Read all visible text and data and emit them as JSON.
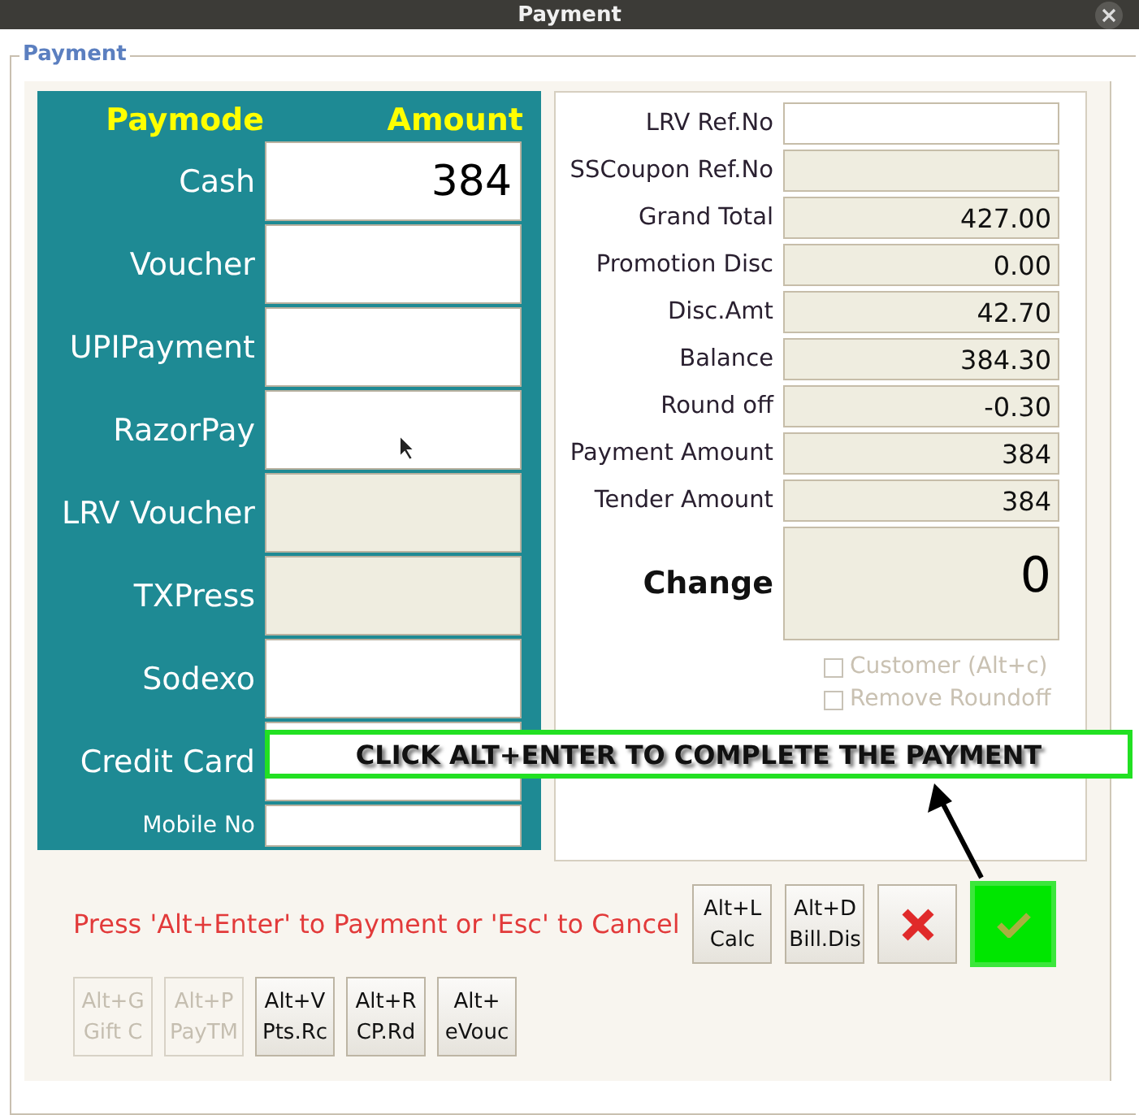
{
  "window": {
    "title": "Payment"
  },
  "group_title": "Payment",
  "paymodes": {
    "header_mode": "Paymode",
    "header_amount": "Amount",
    "rows": [
      {
        "label": "Cash",
        "value": "384",
        "disabled": false
      },
      {
        "label": "Voucher",
        "disabled": false
      },
      {
        "label": "UPIPayment",
        "disabled": false
      },
      {
        "label": "RazorPay",
        "disabled": false
      },
      {
        "label": "LRV Voucher",
        "disabled": true
      },
      {
        "label": "TXPress",
        "disabled": true
      },
      {
        "label": "Sodexo",
        "disabled": false
      },
      {
        "label": "Credit Card",
        "disabled": false
      }
    ],
    "mobile_label": "Mobile No"
  },
  "summary": [
    {
      "label": "LRV Ref.No",
      "disabled": false
    },
    {
      "label": "SSCoupon Ref.No",
      "disabled": true
    },
    {
      "label": "Grand Total",
      "value": "427.00",
      "disabled": true
    },
    {
      "label": "Promotion Disc",
      "value": "0.00",
      "disabled": true
    },
    {
      "label": "Disc.Amt",
      "value": "42.70",
      "disabled": true
    },
    {
      "label": "Balance",
      "value": "384.30",
      "disabled": true
    },
    {
      "label": "Round off",
      "value": "-0.30",
      "disabled": true
    },
    {
      "label": "Payment Amount",
      "value": "384",
      "disabled": true
    },
    {
      "label": "Tender Amount",
      "value": "384",
      "disabled": true
    }
  ],
  "change": {
    "label": "Change",
    "value": "0"
  },
  "options": [
    {
      "label": "Customer (Alt+c)",
      "checked": false
    },
    {
      "label": "Remove Roundoff",
      "checked": false
    }
  ],
  "hint": "Press 'Alt+Enter' to Payment or 'Esc' to Cancel",
  "action_buttons": [
    {
      "kind": "text",
      "line1": "Alt+L",
      "line2": "Calc"
    },
    {
      "kind": "text",
      "line1": "Alt+D",
      "line2": "Bill.Dis"
    },
    {
      "kind": "cancel"
    },
    {
      "kind": "confirm"
    }
  ],
  "shortcut_buttons": [
    {
      "line1": "Alt+G",
      "line2": "Gift C",
      "disabled": true
    },
    {
      "line1": "Alt+P",
      "line2": "PayTM",
      "disabled": true
    },
    {
      "line1": "Alt+V",
      "line2": "Pts.Rc",
      "disabled": false
    },
    {
      "line1": "Alt+R",
      "line2": "CP.Rd",
      "disabled": false
    },
    {
      "line1": "Alt+",
      "line2": "eVouc",
      "disabled": false
    }
  ],
  "callout": "CLICK ALT+ENTER TO COMPLETE THE PAYMENT"
}
